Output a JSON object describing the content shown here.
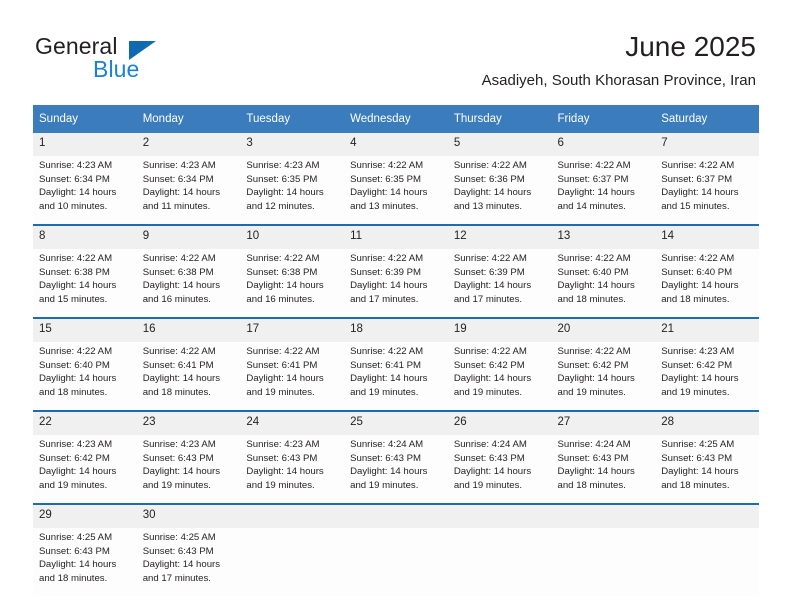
{
  "brand": {
    "name_part1": "General",
    "name_part2": "Blue",
    "triangle_icon": "blue-triangle-logo-mark",
    "accent_color": "#1169b0",
    "blue_text_color": "#1c81d4"
  },
  "header": {
    "title": "June 2025",
    "subtitle": "Asadiyeh, South Khorasan Province, Iran"
  },
  "theme": {
    "header_row_bg": "#3b7cbd",
    "header_row_text": "#ffffff",
    "week_separator": "#1d6cb0",
    "daynum_bg": "#f0f0f0",
    "cell_bg": "#fdfdfd",
    "text_color": "#231f20"
  },
  "calendar": {
    "weekdays": [
      "Sunday",
      "Monday",
      "Tuesday",
      "Wednesday",
      "Thursday",
      "Friday",
      "Saturday"
    ],
    "weeks": [
      [
        {
          "day": "1",
          "sunrise": "Sunrise: 4:23 AM",
          "sunset": "Sunset: 6:34 PM",
          "daylight_line1": "Daylight: 14 hours",
          "daylight_line2": "and 10 minutes."
        },
        {
          "day": "2",
          "sunrise": "Sunrise: 4:23 AM",
          "sunset": "Sunset: 6:34 PM",
          "daylight_line1": "Daylight: 14 hours",
          "daylight_line2": "and 11 minutes."
        },
        {
          "day": "3",
          "sunrise": "Sunrise: 4:23 AM",
          "sunset": "Sunset: 6:35 PM",
          "daylight_line1": "Daylight: 14 hours",
          "daylight_line2": "and 12 minutes."
        },
        {
          "day": "4",
          "sunrise": "Sunrise: 4:22 AM",
          "sunset": "Sunset: 6:35 PM",
          "daylight_line1": "Daylight: 14 hours",
          "daylight_line2": "and 13 minutes."
        },
        {
          "day": "5",
          "sunrise": "Sunrise: 4:22 AM",
          "sunset": "Sunset: 6:36 PM",
          "daylight_line1": "Daylight: 14 hours",
          "daylight_line2": "and 13 minutes."
        },
        {
          "day": "6",
          "sunrise": "Sunrise: 4:22 AM",
          "sunset": "Sunset: 6:37 PM",
          "daylight_line1": "Daylight: 14 hours",
          "daylight_line2": "and 14 minutes."
        },
        {
          "day": "7",
          "sunrise": "Sunrise: 4:22 AM",
          "sunset": "Sunset: 6:37 PM",
          "daylight_line1": "Daylight: 14 hours",
          "daylight_line2": "and 15 minutes."
        }
      ],
      [
        {
          "day": "8",
          "sunrise": "Sunrise: 4:22 AM",
          "sunset": "Sunset: 6:38 PM",
          "daylight_line1": "Daylight: 14 hours",
          "daylight_line2": "and 15 minutes."
        },
        {
          "day": "9",
          "sunrise": "Sunrise: 4:22 AM",
          "sunset": "Sunset: 6:38 PM",
          "daylight_line1": "Daylight: 14 hours",
          "daylight_line2": "and 16 minutes."
        },
        {
          "day": "10",
          "sunrise": "Sunrise: 4:22 AM",
          "sunset": "Sunset: 6:38 PM",
          "daylight_line1": "Daylight: 14 hours",
          "daylight_line2": "and 16 minutes."
        },
        {
          "day": "11",
          "sunrise": "Sunrise: 4:22 AM",
          "sunset": "Sunset: 6:39 PM",
          "daylight_line1": "Daylight: 14 hours",
          "daylight_line2": "and 17 minutes."
        },
        {
          "day": "12",
          "sunrise": "Sunrise: 4:22 AM",
          "sunset": "Sunset: 6:39 PM",
          "daylight_line1": "Daylight: 14 hours",
          "daylight_line2": "and 17 minutes."
        },
        {
          "day": "13",
          "sunrise": "Sunrise: 4:22 AM",
          "sunset": "Sunset: 6:40 PM",
          "daylight_line1": "Daylight: 14 hours",
          "daylight_line2": "and 18 minutes."
        },
        {
          "day": "14",
          "sunrise": "Sunrise: 4:22 AM",
          "sunset": "Sunset: 6:40 PM",
          "daylight_line1": "Daylight: 14 hours",
          "daylight_line2": "and 18 minutes."
        }
      ],
      [
        {
          "day": "15",
          "sunrise": "Sunrise: 4:22 AM",
          "sunset": "Sunset: 6:40 PM",
          "daylight_line1": "Daylight: 14 hours",
          "daylight_line2": "and 18 minutes."
        },
        {
          "day": "16",
          "sunrise": "Sunrise: 4:22 AM",
          "sunset": "Sunset: 6:41 PM",
          "daylight_line1": "Daylight: 14 hours",
          "daylight_line2": "and 18 minutes."
        },
        {
          "day": "17",
          "sunrise": "Sunrise: 4:22 AM",
          "sunset": "Sunset: 6:41 PM",
          "daylight_line1": "Daylight: 14 hours",
          "daylight_line2": "and 19 minutes."
        },
        {
          "day": "18",
          "sunrise": "Sunrise: 4:22 AM",
          "sunset": "Sunset: 6:41 PM",
          "daylight_line1": "Daylight: 14 hours",
          "daylight_line2": "and 19 minutes."
        },
        {
          "day": "19",
          "sunrise": "Sunrise: 4:22 AM",
          "sunset": "Sunset: 6:42 PM",
          "daylight_line1": "Daylight: 14 hours",
          "daylight_line2": "and 19 minutes."
        },
        {
          "day": "20",
          "sunrise": "Sunrise: 4:22 AM",
          "sunset": "Sunset: 6:42 PM",
          "daylight_line1": "Daylight: 14 hours",
          "daylight_line2": "and 19 minutes."
        },
        {
          "day": "21",
          "sunrise": "Sunrise: 4:23 AM",
          "sunset": "Sunset: 6:42 PM",
          "daylight_line1": "Daylight: 14 hours",
          "daylight_line2": "and 19 minutes."
        }
      ],
      [
        {
          "day": "22",
          "sunrise": "Sunrise: 4:23 AM",
          "sunset": "Sunset: 6:42 PM",
          "daylight_line1": "Daylight: 14 hours",
          "daylight_line2": "and 19 minutes."
        },
        {
          "day": "23",
          "sunrise": "Sunrise: 4:23 AM",
          "sunset": "Sunset: 6:43 PM",
          "daylight_line1": "Daylight: 14 hours",
          "daylight_line2": "and 19 minutes."
        },
        {
          "day": "24",
          "sunrise": "Sunrise: 4:23 AM",
          "sunset": "Sunset: 6:43 PM",
          "daylight_line1": "Daylight: 14 hours",
          "daylight_line2": "and 19 minutes."
        },
        {
          "day": "25",
          "sunrise": "Sunrise: 4:24 AM",
          "sunset": "Sunset: 6:43 PM",
          "daylight_line1": "Daylight: 14 hours",
          "daylight_line2": "and 19 minutes."
        },
        {
          "day": "26",
          "sunrise": "Sunrise: 4:24 AM",
          "sunset": "Sunset: 6:43 PM",
          "daylight_line1": "Daylight: 14 hours",
          "daylight_line2": "and 19 minutes."
        },
        {
          "day": "27",
          "sunrise": "Sunrise: 4:24 AM",
          "sunset": "Sunset: 6:43 PM",
          "daylight_line1": "Daylight: 14 hours",
          "daylight_line2": "and 18 minutes."
        },
        {
          "day": "28",
          "sunrise": "Sunrise: 4:25 AM",
          "sunset": "Sunset: 6:43 PM",
          "daylight_line1": "Daylight: 14 hours",
          "daylight_line2": "and 18 minutes."
        }
      ],
      [
        {
          "day": "29",
          "sunrise": "Sunrise: 4:25 AM",
          "sunset": "Sunset: 6:43 PM",
          "daylight_line1": "Daylight: 14 hours",
          "daylight_line2": "and 18 minutes."
        },
        {
          "day": "30",
          "sunrise": "Sunrise: 4:25 AM",
          "sunset": "Sunset: 6:43 PM",
          "daylight_line1": "Daylight: 14 hours",
          "daylight_line2": "and 17 minutes."
        },
        {
          "day": "",
          "sunrise": "",
          "sunset": "",
          "daylight_line1": "",
          "daylight_line2": ""
        },
        {
          "day": "",
          "sunrise": "",
          "sunset": "",
          "daylight_line1": "",
          "daylight_line2": ""
        },
        {
          "day": "",
          "sunrise": "",
          "sunset": "",
          "daylight_line1": "",
          "daylight_line2": ""
        },
        {
          "day": "",
          "sunrise": "",
          "sunset": "",
          "daylight_line1": "",
          "daylight_line2": ""
        },
        {
          "day": "",
          "sunrise": "",
          "sunset": "",
          "daylight_line1": "",
          "daylight_line2": ""
        }
      ]
    ]
  }
}
